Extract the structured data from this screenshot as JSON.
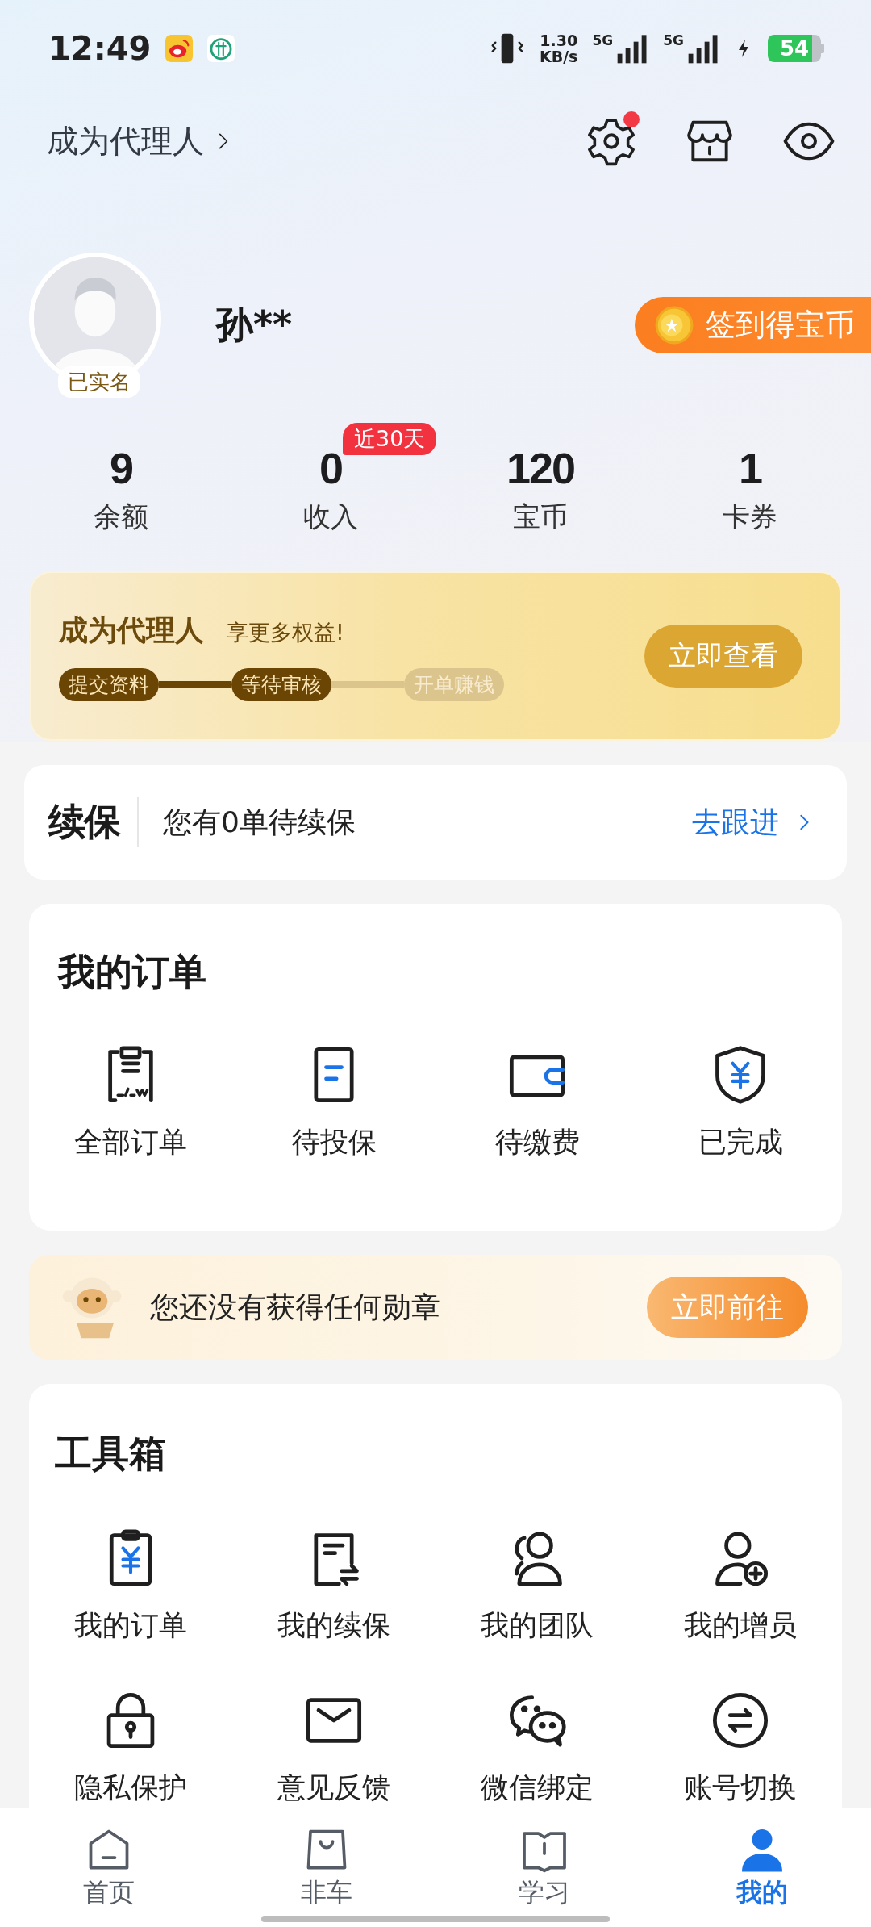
{
  "status_bar": {
    "time": "12:49",
    "speed": "1.30",
    "speed_unit": "KB/s",
    "networks": [
      "5G",
      "5G"
    ],
    "battery": "54"
  },
  "header": {
    "agent_link": "成为代理人",
    "settings_notification": true
  },
  "profile": {
    "name": "孙**",
    "verified_badge": "已实名",
    "checkin_button": "签到得宝币"
  },
  "stats": [
    {
      "value": "9",
      "label": "余额"
    },
    {
      "value": "0",
      "label": "收入",
      "tag": "近30天"
    },
    {
      "value": "120",
      "label": "宝币"
    },
    {
      "value": "1",
      "label": "卡券"
    }
  ],
  "agent_banner": {
    "title": "成为代理人",
    "subtitle": "享更多权益!",
    "button": "立即查看",
    "steps": [
      {
        "label": "提交资料",
        "done": true
      },
      {
        "label": "等待审核",
        "done": true
      },
      {
        "label": "开单赚钱",
        "done": false
      }
    ]
  },
  "renewal": {
    "logo": "续保",
    "text": "您有0单待续保",
    "link": "去跟进"
  },
  "orders": {
    "title": "我的订单",
    "items": [
      {
        "label": "全部订单"
      },
      {
        "label": "待投保"
      },
      {
        "label": "待缴费"
      },
      {
        "label": "已完成"
      }
    ]
  },
  "medal_banner": {
    "text": "您还没有获得任何勋章",
    "button": "立即前往"
  },
  "toolbox": {
    "title": "工具箱",
    "items": [
      {
        "label": "我的订单"
      },
      {
        "label": "我的续保"
      },
      {
        "label": "我的团队"
      },
      {
        "label": "我的增员"
      },
      {
        "label": "隐私保护"
      },
      {
        "label": "意见反馈"
      },
      {
        "label": "微信绑定"
      },
      {
        "label": "账号切换"
      }
    ]
  },
  "bottom_nav": [
    {
      "label": "首页",
      "selected": false
    },
    {
      "label": "非车",
      "selected": false
    },
    {
      "label": "学习",
      "selected": false
    },
    {
      "label": "我的",
      "selected": true
    }
  ]
}
